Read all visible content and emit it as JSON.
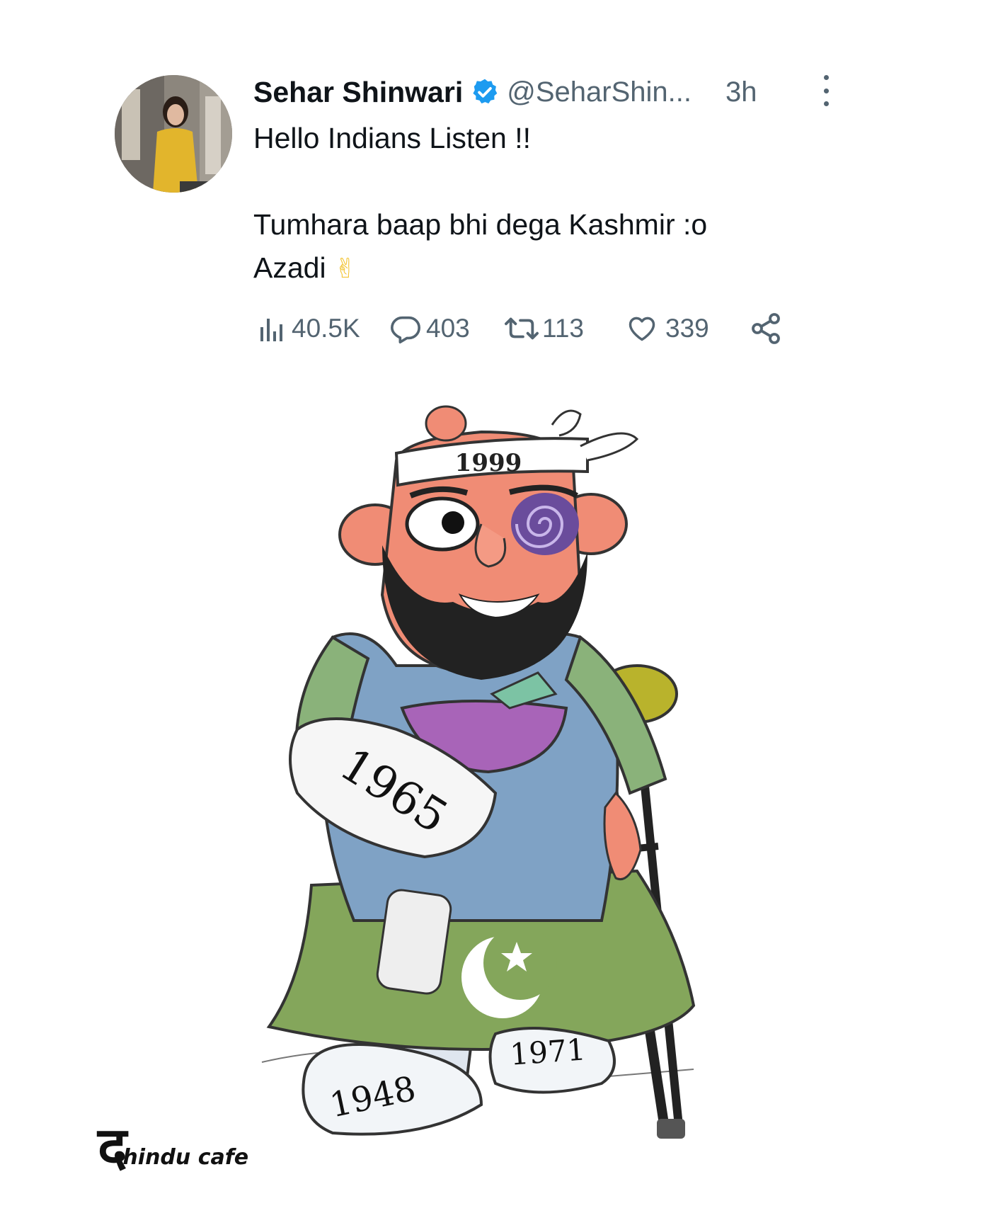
{
  "tweet": {
    "author": {
      "display_name": "Sehar Shinwari",
      "verified": true,
      "handle": "@SeharShin...",
      "avatar_icon": "profile-photo"
    },
    "time": "3h",
    "text": "Hello Indians Listen !!\n\nTumhara baap bhi dega Kashmir :o\nAzadi",
    "emoji": "✌",
    "stats": {
      "views": "40.5K",
      "replies": "403",
      "retweets": "113",
      "likes": "339"
    },
    "icons": {
      "views": "views-chart-icon",
      "replies": "reply-icon",
      "retweets": "retweet-icon",
      "likes": "heart-icon",
      "share": "share-icon",
      "more": "more-options-icon"
    },
    "accent_color": "#1d9bf0",
    "muted_color": "#536471"
  },
  "cartoon": {
    "labels": {
      "headband": "1999",
      "arm_cast": "1965",
      "left_foot": "1948",
      "right_foot": "1971"
    },
    "symbol": "crescent-and-star"
  },
  "watermark": {
    "mark": "द",
    "text": "hindu cafe"
  }
}
